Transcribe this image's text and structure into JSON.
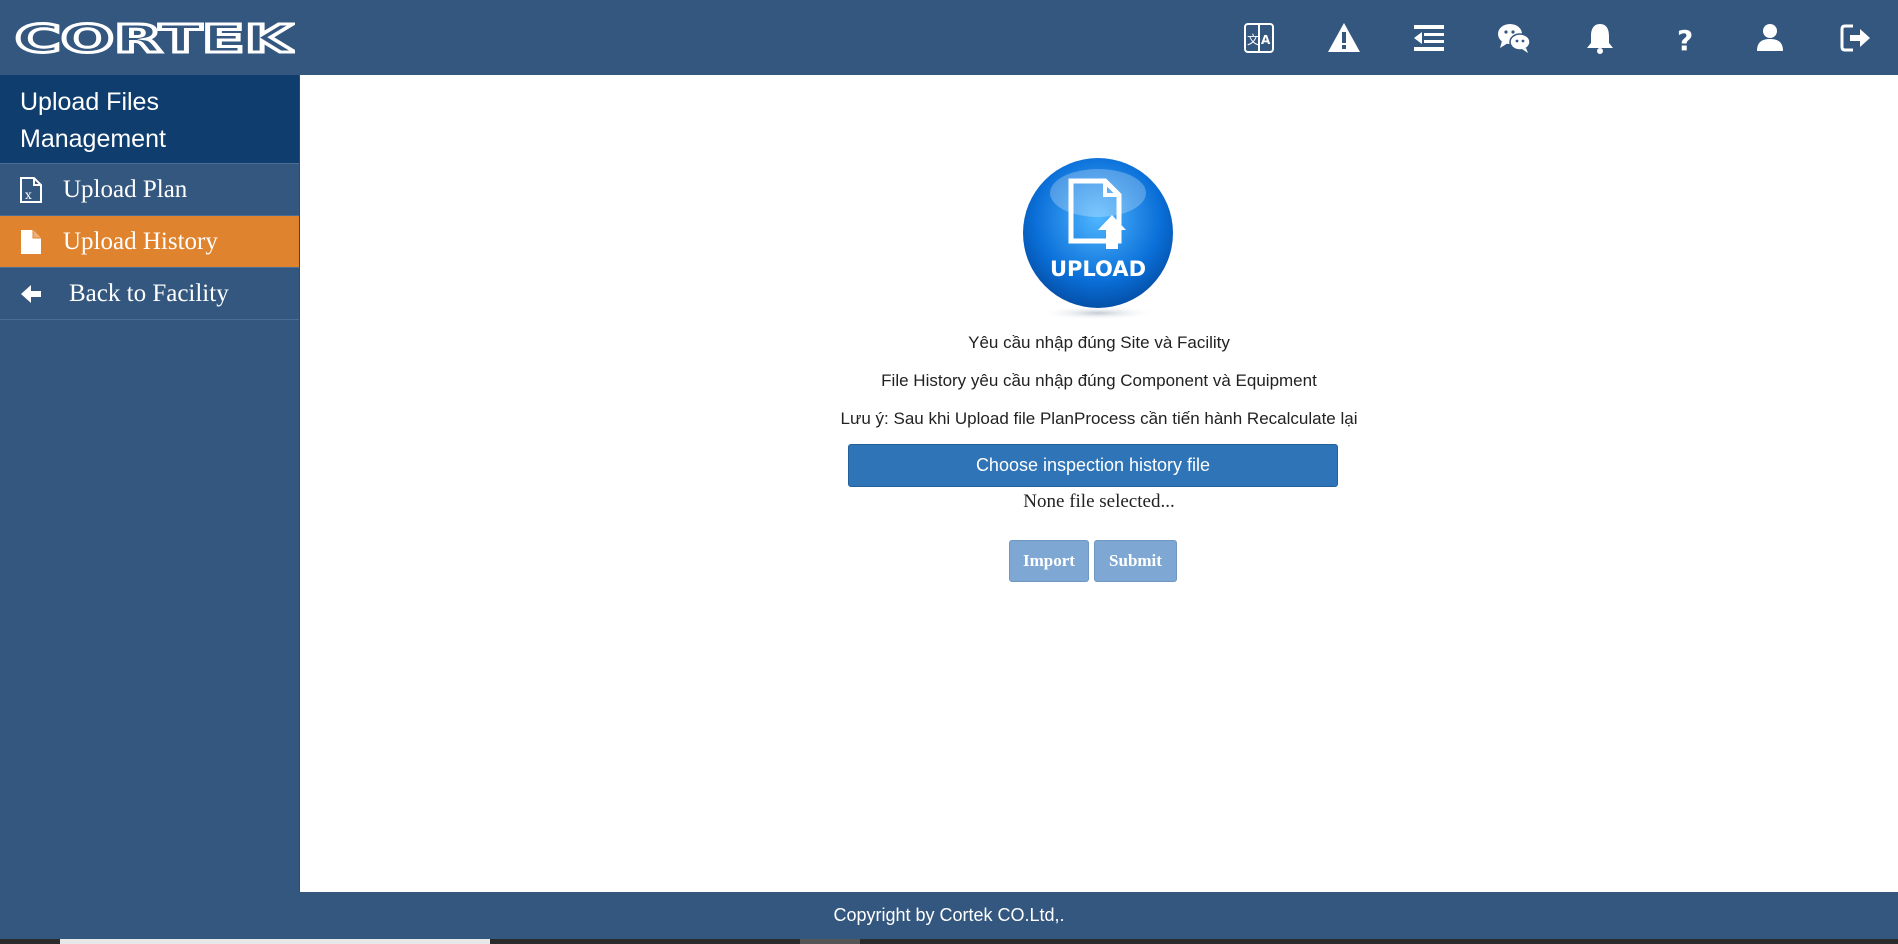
{
  "brand": {
    "logo_text": "CORTEK"
  },
  "header": {
    "icons": [
      "translate-icon",
      "warning-icon",
      "menu-indent-icon",
      "chat-icon",
      "bell-icon",
      "question-icon",
      "user-icon",
      "logout-icon"
    ]
  },
  "sidebar": {
    "title": "Upload Files Management",
    "items": [
      {
        "label": "Upload Plan",
        "icon": "excel-file-icon",
        "active": false
      },
      {
        "label": "Upload History",
        "icon": "file-icon",
        "active": true
      },
      {
        "label": "Back to Facility",
        "icon": "arrow-left-icon",
        "active": false
      }
    ]
  },
  "main": {
    "upload_badge_text": "UPLOAD",
    "notes": [
      "Yêu cầu nhập đúng Site và Facility",
      "File History yêu cầu nhập đúng Component và Equipment",
      "Lưu ý: Sau khi Upload file PlanProcess cần tiến hành Recalculate lại"
    ],
    "choose_button": "Choose inspection history file",
    "file_status": "None file selected...",
    "import_button": "Import",
    "submit_button": "Submit"
  },
  "footer": {
    "copyright": "Copyright by Cortek CO.Ltd,."
  },
  "colors": {
    "header_bg": "#34577f",
    "sidebar_header_bg": "#0e3d6e",
    "active_item": "#e0832f",
    "primary_button": "#2e74b7",
    "disabled_button": "#7ea8d3"
  }
}
